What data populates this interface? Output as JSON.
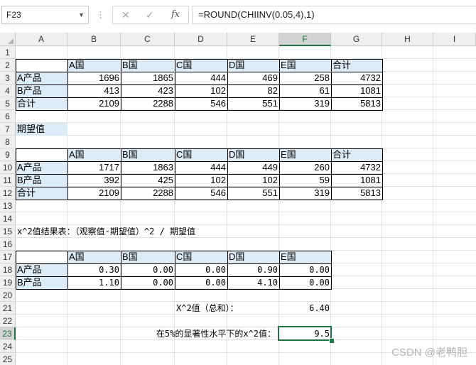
{
  "formula_bar": {
    "name_box": "F23",
    "dots": "⋮",
    "cancel_icon": "✕",
    "enter_icon": "✓",
    "fx_label": "fx",
    "formula": "=ROUND(CHIINV(0.05,4),1)"
  },
  "columns": [
    "A",
    "B",
    "C",
    "D",
    "E",
    "F",
    "G",
    "H",
    "I"
  ],
  "rows": [
    "1",
    "2",
    "3",
    "4",
    "5",
    "6",
    "7",
    "8",
    "9",
    "10",
    "11",
    "12",
    "13",
    "14",
    "15",
    "16",
    "17",
    "18",
    "19",
    "20",
    "21",
    "22",
    "23",
    "24",
    "25"
  ],
  "observed": {
    "header": [
      "A国",
      "B国",
      "C国",
      "D国",
      "E国",
      "合计"
    ],
    "rows": [
      {
        "label": "A产品",
        "values": [
          "1696",
          "1865",
          "444",
          "469",
          "258",
          "4732"
        ]
      },
      {
        "label": "B产品",
        "values": [
          "413",
          "423",
          "102",
          "82",
          "61",
          "1081"
        ]
      },
      {
        "label": "合计",
        "values": [
          "2109",
          "2288",
          "546",
          "551",
          "319",
          "5813"
        ]
      }
    ]
  },
  "expected_title": "期望值",
  "expected": {
    "header": [
      "A国",
      "B国",
      "C国",
      "D国",
      "E国",
      "合计"
    ],
    "rows": [
      {
        "label": "A产品",
        "values": [
          "1717",
          "1863",
          "444",
          "449",
          "260",
          "4732"
        ]
      },
      {
        "label": "B产品",
        "values": [
          "392",
          "425",
          "102",
          "102",
          "59",
          "1081"
        ]
      },
      {
        "label": "合计",
        "values": [
          "2109",
          "2288",
          "546",
          "551",
          "319",
          "5813"
        ]
      }
    ]
  },
  "chi_title": "x^2值结果表：（观察值-期望值）^2 / 期望值",
  "chi": {
    "header": [
      "A国",
      "B国",
      "C国",
      "D国",
      "E国"
    ],
    "rows": [
      {
        "label": "A产品",
        "values": [
          "0.30",
          "0.00",
          "0.00",
          "0.90",
          "0.00"
        ]
      },
      {
        "label": "B产品",
        "values": [
          "1.10",
          "0.00",
          "0.00",
          "4.10",
          "0.00"
        ]
      }
    ]
  },
  "chi_total_label": "X^2值（总和）：",
  "chi_total_value": "6.40",
  "critical_label": "在5%的显著性水平下的x^2值：",
  "critical_value": "9.5",
  "watermark": "CSDN @老鸭胆"
}
